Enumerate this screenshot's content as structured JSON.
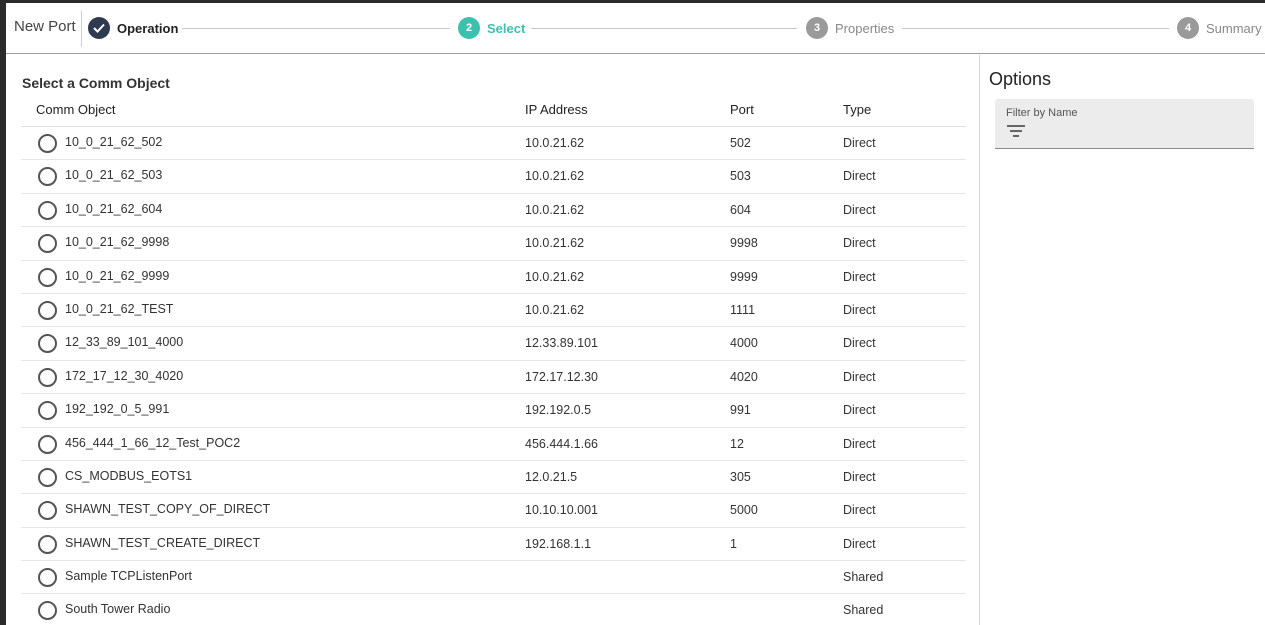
{
  "dialog": {
    "title": "New Port"
  },
  "stepper": {
    "steps": [
      {
        "number": "",
        "label": "Operation",
        "state": "done"
      },
      {
        "number": "2",
        "label": "Select",
        "state": "active"
      },
      {
        "number": "3",
        "label": "Properties",
        "state": "pending"
      },
      {
        "number": "4",
        "label": "Summary",
        "state": "pending"
      }
    ]
  },
  "main": {
    "section_title": "Select a Comm Object",
    "columns": [
      "Comm Object",
      "IP Address",
      "Port",
      "Type"
    ],
    "rows": [
      {
        "name": "10_0_21_62_502",
        "ip": "10.0.21.62",
        "port": "502",
        "type": "Direct"
      },
      {
        "name": "10_0_21_62_503",
        "ip": "10.0.21.62",
        "port": "503",
        "type": "Direct"
      },
      {
        "name": "10_0_21_62_604",
        "ip": "10.0.21.62",
        "port": "604",
        "type": "Direct"
      },
      {
        "name": "10_0_21_62_9998",
        "ip": "10.0.21.62",
        "port": "9998",
        "type": "Direct"
      },
      {
        "name": "10_0_21_62_9999",
        "ip": "10.0.21.62",
        "port": "9999",
        "type": "Direct"
      },
      {
        "name": "10_0_21_62_TEST",
        "ip": "10.0.21.62",
        "port": "1111",
        "type": "Direct"
      },
      {
        "name": "12_33_89_101_4000",
        "ip": "12.33.89.101",
        "port": "4000",
        "type": "Direct"
      },
      {
        "name": "172_17_12_30_4020",
        "ip": "172.17.12.30",
        "port": "4020",
        "type": "Direct"
      },
      {
        "name": "192_192_0_5_991",
        "ip": "192.192.0.5",
        "port": "991",
        "type": "Direct"
      },
      {
        "name": "456_444_1_66_12_Test_POC2",
        "ip": "456.444.1.66",
        "port": "12",
        "type": "Direct"
      },
      {
        "name": "CS_MODBUS_EOTS1",
        "ip": "12.0.21.5",
        "port": "305",
        "type": "Direct"
      },
      {
        "name": "SHAWN_TEST_COPY_OF_DIRECT",
        "ip": "10.10.10.001",
        "port": "5000",
        "type": "Direct"
      },
      {
        "name": "SHAWN_TEST_CREATE_DIRECT",
        "ip": "192.168.1.1",
        "port": "1",
        "type": "Direct"
      },
      {
        "name": "Sample TCPListenPort",
        "ip": "",
        "port": "",
        "type": "Shared"
      },
      {
        "name": "South Tower Radio",
        "ip": "",
        "port": "",
        "type": "Shared"
      }
    ]
  },
  "options": {
    "title": "Options",
    "filter_label": "Filter by Name",
    "filter_icon": "filter-list-icon"
  },
  "colors": {
    "active_step": "#3cc1ae",
    "done_step": "#2e3a4f",
    "pending_step": "#9a9a9a"
  }
}
